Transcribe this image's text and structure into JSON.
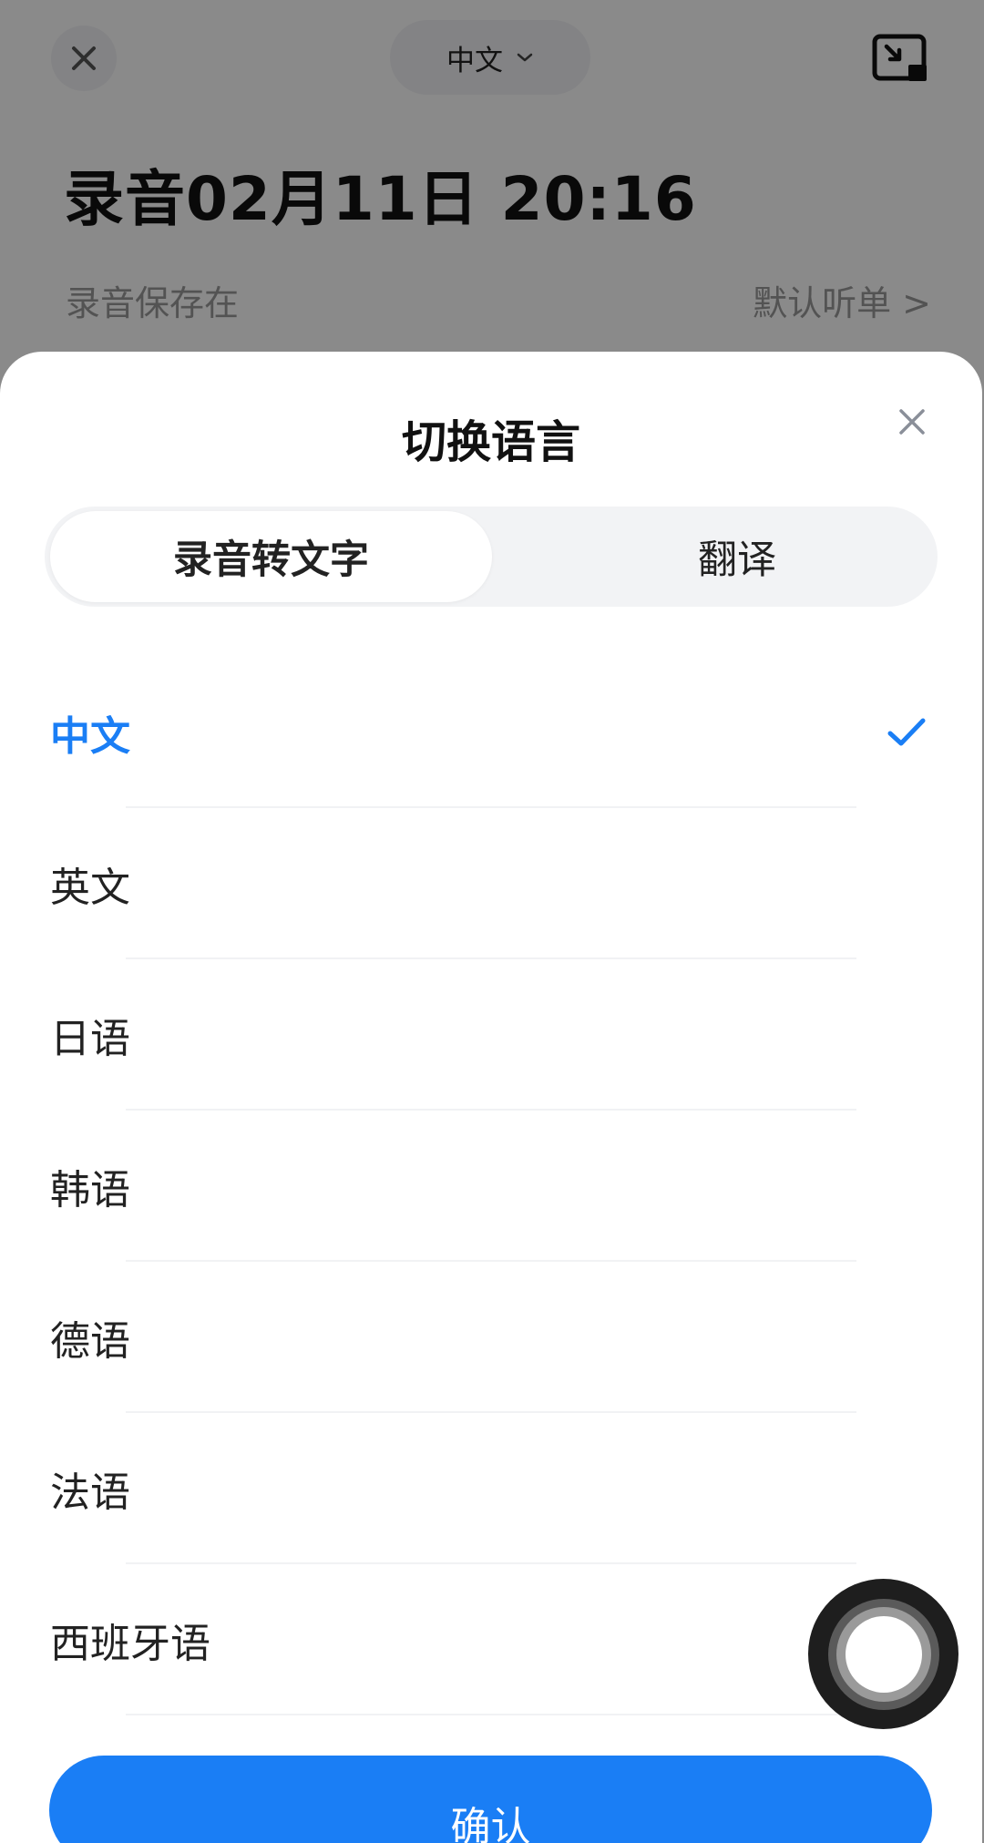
{
  "background": {
    "language_selector": "中文",
    "title": "录音02月11日  20:16",
    "saved_label": "录音保存在",
    "playlist_link": "默认听单 >"
  },
  "sheet": {
    "title": "切换语言",
    "tabs": [
      {
        "label": "录音转文字",
        "active": true
      },
      {
        "label": "翻译",
        "active": false
      }
    ],
    "languages": [
      {
        "label": "中文",
        "selected": true
      },
      {
        "label": "英文",
        "selected": false
      },
      {
        "label": "日语",
        "selected": false
      },
      {
        "label": "韩语",
        "selected": false
      },
      {
        "label": "德语",
        "selected": false
      },
      {
        "label": "法语",
        "selected": false
      },
      {
        "label": "西班牙语",
        "selected": false
      }
    ],
    "confirm_label": "确认"
  },
  "colors": {
    "accent": "#1a7ef5",
    "overlay": "rgba(0,0,0,0.46)"
  },
  "icons": {
    "bg_close": "close-icon",
    "bg_dropdown": "chevron-down-icon",
    "bg_pip": "picture-in-picture-icon",
    "sheet_close": "close-icon",
    "selected_check": "checkmark-icon",
    "assistive_touch": "assistive-touch-icon"
  }
}
